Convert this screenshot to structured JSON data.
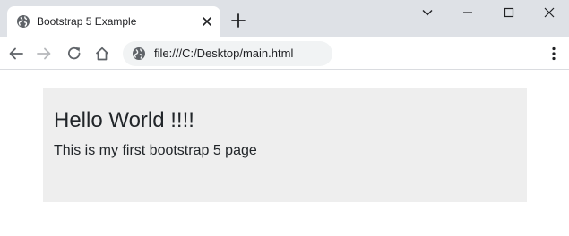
{
  "tab": {
    "title": "Bootstrap 5 Example",
    "favicon_icon": "globe-icon",
    "close_icon": "close-icon"
  },
  "tabstrip": {
    "new_tab_icon": "plus-icon",
    "tab_search_icon": "chevron-down-icon"
  },
  "window_controls": {
    "minimize_icon": "minimize-icon",
    "maximize_icon": "maximize-icon",
    "close_icon": "close-icon"
  },
  "toolbar": {
    "back_icon": "arrow-left-icon",
    "forward_icon": "arrow-right-icon",
    "reload_icon": "reload-icon",
    "home_icon": "home-icon",
    "address": "file:///C:/Desktop/main.html",
    "site_info_icon": "globe-icon",
    "menu_icon": "kebab-menu-icon"
  },
  "page": {
    "heading": "Hello World !!!!",
    "paragraph": "This is my first bootstrap 5 page"
  },
  "colors": {
    "tabstrip_bg": "#dee1e6",
    "omnibox_bg": "#f1f3f4",
    "jumbotron_bg": "#eeeeee",
    "text": "#212529"
  }
}
